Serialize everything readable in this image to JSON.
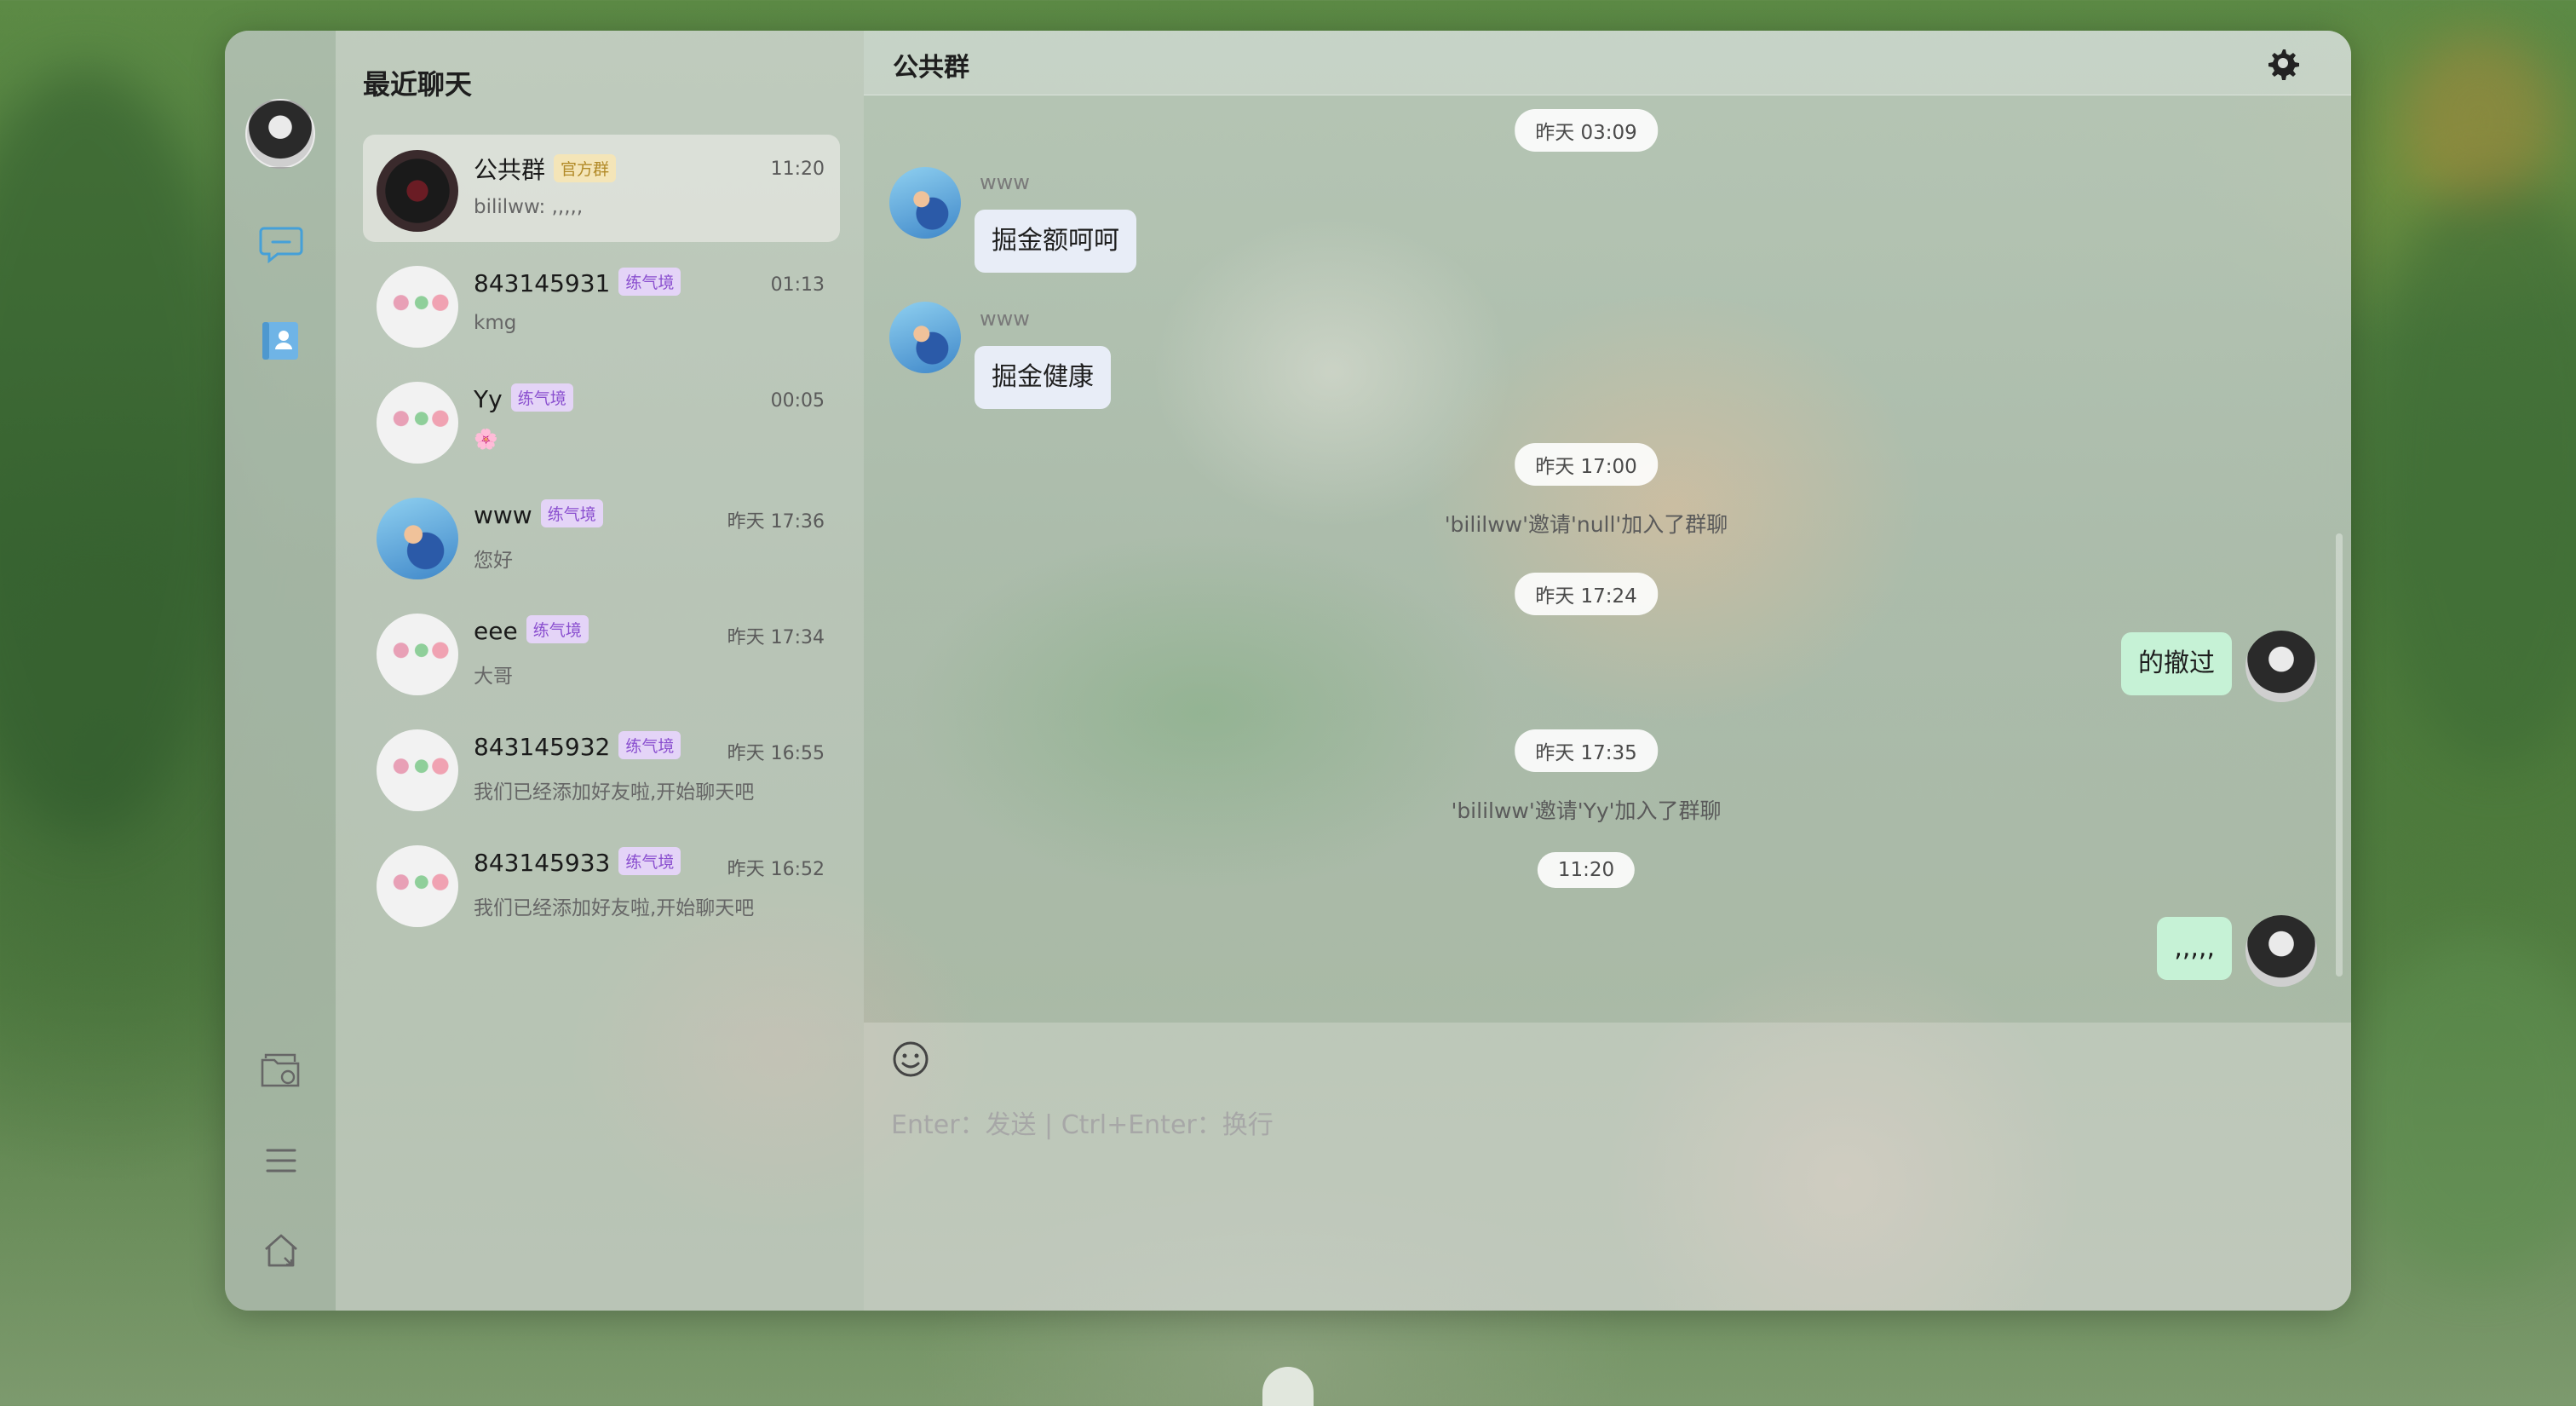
{
  "sidebar": {
    "icons": [
      "chat-bubble-icon",
      "contacts-icon",
      "folder-icon",
      "menu-icon",
      "home-icon"
    ]
  },
  "conversation_list": {
    "title": "最近聊天",
    "items": [
      {
        "name": "公共群",
        "badge": "官方群",
        "time": "11:20",
        "preview": "bililww: ,,,,,"
      },
      {
        "name": "843145931",
        "badge": "练气境",
        "time": "01:13",
        "preview": "kmg"
      },
      {
        "name": "Yy",
        "badge": "练气境",
        "time": "00:05",
        "preview": "🌸"
      },
      {
        "name": "www",
        "badge": "练气境",
        "time": "昨天 17:36",
        "preview": "您好"
      },
      {
        "name": "eee",
        "badge": "练气境",
        "time": "昨天 17:34",
        "preview": "大哥"
      },
      {
        "name": "843145932",
        "badge": "练气境",
        "time": "昨天 16:55",
        "preview": "我们已经添加好友啦,开始聊天吧"
      },
      {
        "name": "843145933",
        "badge": "练气境",
        "time": "昨天 16:52",
        "preview": "我们已经添加好友啦,开始聊天吧"
      }
    ]
  },
  "chat": {
    "title": "公共群",
    "timestamps": [
      "昨天 03:09",
      "昨天 17:00",
      "昨天 17:24",
      "昨天 17:35",
      "11:20"
    ],
    "messages": [
      {
        "sender": "www",
        "text": "掘金额呵呵"
      },
      {
        "sender": "www",
        "text": "掘金健康"
      }
    ],
    "system": [
      "'bililww'邀请'null'加入了群聊",
      "'bililww'邀请'Yy'加入了群聊"
    ],
    "outgoing": [
      "的撤过",
      ",,,,,"
    ]
  },
  "composer": {
    "placeholder": "Enter：发送 | Ctrl+Enter：换行",
    "value": ""
  },
  "colors": {
    "bubble_in": "#e8edf7",
    "bubble_out": "#c6f2d6",
    "badge_official_bg": "#f4e5b8",
    "badge_level_bg": "#e4d4f7"
  }
}
